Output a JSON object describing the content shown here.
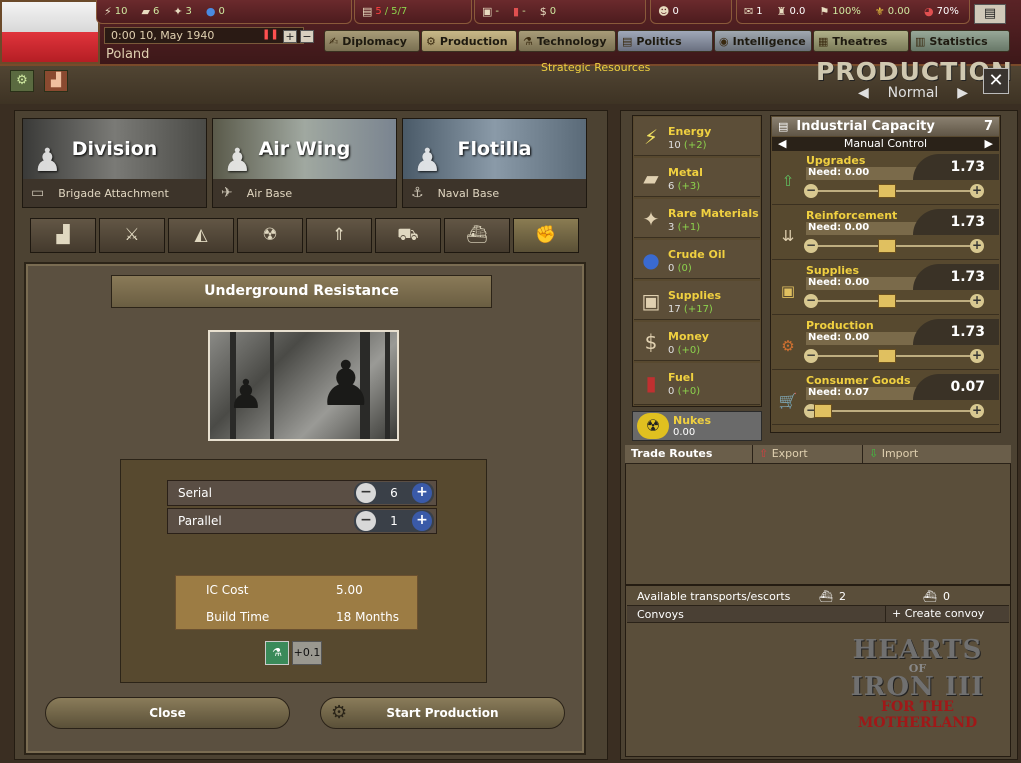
{
  "topbar": {
    "flag_colors": [
      "#f4f4f4",
      "#dc2b32"
    ],
    "resources": [
      {
        "icon": "energy-icon",
        "glyph": "⚡",
        "value": "10"
      },
      {
        "icon": "metal-icon",
        "glyph": "▰",
        "value": "6"
      },
      {
        "icon": "rare-materials-icon",
        "glyph": "✦",
        "value": "3"
      },
      {
        "icon": "crude-oil-icon",
        "glyph": "💧",
        "value": "0"
      }
    ],
    "ic": {
      "used": "5",
      "total": "5/7"
    },
    "supplies": "-",
    "fuel": "-",
    "money": "0",
    "manpower": "0",
    "diplo_influence": "1",
    "officers": "0.0",
    "dissent_flag": "100%",
    "leadership": "0.00",
    "national_unity": "70%",
    "date": "0:00 10, May 1940",
    "country": "Poland",
    "tabs": [
      {
        "label": "Diplomacy",
        "icon": "handshake-icon",
        "glyph": "✍"
      },
      {
        "label": "Production",
        "icon": "factory-icon",
        "glyph": "⚙"
      },
      {
        "label": "Technology",
        "icon": "technology-icon",
        "glyph": "⚗"
      },
      {
        "label": "Politics",
        "icon": "politics-icon",
        "glyph": "▤"
      },
      {
        "label": "Intelligence",
        "icon": "intelligence-icon",
        "glyph": "◉"
      },
      {
        "label": "Theatres",
        "icon": "theatres-icon",
        "glyph": "▦"
      },
      {
        "label": "Statistics",
        "icon": "statistics-icon",
        "glyph": "▥"
      }
    ]
  },
  "header": {
    "strategic_resources": "Strategic Resources",
    "title": "PRODUCTION",
    "mode": "Normal"
  },
  "units": [
    {
      "name": "Division",
      "sub": "Brigade Attachment",
      "sub_icon": "brigade-icon",
      "glyph": "▭"
    },
    {
      "name": "Air Wing",
      "sub": "Air Base",
      "sub_icon": "air-base-icon",
      "glyph": "✈"
    },
    {
      "name": "Flotilla",
      "sub": "Naval Base",
      "sub_icon": "anchor-icon",
      "glyph": "⚓"
    }
  ],
  "categories": [
    {
      "icon": "industry-icon",
      "glyph": "🏭"
    },
    {
      "icon": "artillery-icon",
      "glyph": "⚔"
    },
    {
      "icon": "radar-icon",
      "glyph": "📡"
    },
    {
      "icon": "nuclear-icon",
      "glyph": "☢"
    },
    {
      "icon": "rocket-icon",
      "glyph": "🚀"
    },
    {
      "icon": "naval-yard-icon",
      "glyph": "⛴"
    },
    {
      "icon": "warship-icon",
      "glyph": "🚢"
    },
    {
      "icon": "resistance-fist-icon",
      "glyph": "✊"
    }
  ],
  "selected_unit": {
    "name": "Underground Resistance",
    "serial_label": "Serial",
    "serial_value": "6",
    "parallel_label": "Parallel",
    "parallel_value": "1",
    "ic_cost_label": "IC Cost",
    "ic_cost": "5.00",
    "build_time_label": "Build Time",
    "build_time": "18 Months",
    "bonus": "+0.1"
  },
  "buttons": {
    "close": "Close",
    "start": "Start Production"
  },
  "strategic": [
    {
      "name": "Energy",
      "value": "10",
      "delta": "(+2)",
      "icon": "energy-icon",
      "glyph": "⚡"
    },
    {
      "name": "Metal",
      "value": "6",
      "delta": "(+3)",
      "icon": "metal-icon",
      "glyph": "▰"
    },
    {
      "name": "Rare Materials",
      "value": "3",
      "delta": "(+1)",
      "icon": "rare-materials-icon",
      "glyph": "✦"
    },
    {
      "name": "Crude Oil",
      "value": "0",
      "delta": "(0)",
      "icon": "crude-oil-icon",
      "glyph": "💧"
    },
    {
      "name": "Supplies",
      "value": "17",
      "delta": "(+17)",
      "icon": "supplies-icon",
      "glyph": "▣"
    },
    {
      "name": "Money",
      "value": "0",
      "delta": "(+0)",
      "icon": "money-icon",
      "glyph": "$"
    },
    {
      "name": "Fuel",
      "value": "0",
      "delta": "(+0)",
      "icon": "fuel-icon",
      "glyph": "▮"
    }
  ],
  "nukes": {
    "name": "Nukes",
    "value": "0.00"
  },
  "ic_panel": {
    "title": "Industrial Capacity",
    "value": "7",
    "control": "Manual Control",
    "slots": [
      {
        "name": "Upgrades",
        "need": "Need: 0.00",
        "value": "1.73",
        "icon": "upgrade-arrow-icon",
        "glyph": "⇧",
        "level": 0.27
      },
      {
        "name": "Reinforcement",
        "need": "Need: 0.00",
        "value": "1.73",
        "icon": "reinforcement-icon",
        "glyph": "⇊",
        "level": 0.27
      },
      {
        "name": "Supplies",
        "need": "Need: 0.00",
        "value": "1.73",
        "icon": "supplies-icon",
        "glyph": "▣",
        "level": 0.27
      },
      {
        "name": "Production",
        "need": "Need: 0.00",
        "value": "1.73",
        "icon": "gears-icon",
        "glyph": "⚙",
        "level": 0.27
      },
      {
        "name": "Consumer Goods",
        "need": "Need: 0.07",
        "value": "0.07",
        "icon": "shopping-cart-icon",
        "glyph": "🛒",
        "level": 0.0
      }
    ]
  },
  "trade": {
    "routes": "Trade Routes",
    "export": "Export",
    "import": "Import"
  },
  "convoys": {
    "available": "Available transports/escorts",
    "transports": "2",
    "escorts": "0",
    "label": "Convoys",
    "create": "Create convoy"
  },
  "logo": {
    "line1": "HEARTS",
    "line2": "OF",
    "line3": "IRON III",
    "line4": "FOR THE",
    "line5": "MOTHERLAND"
  }
}
